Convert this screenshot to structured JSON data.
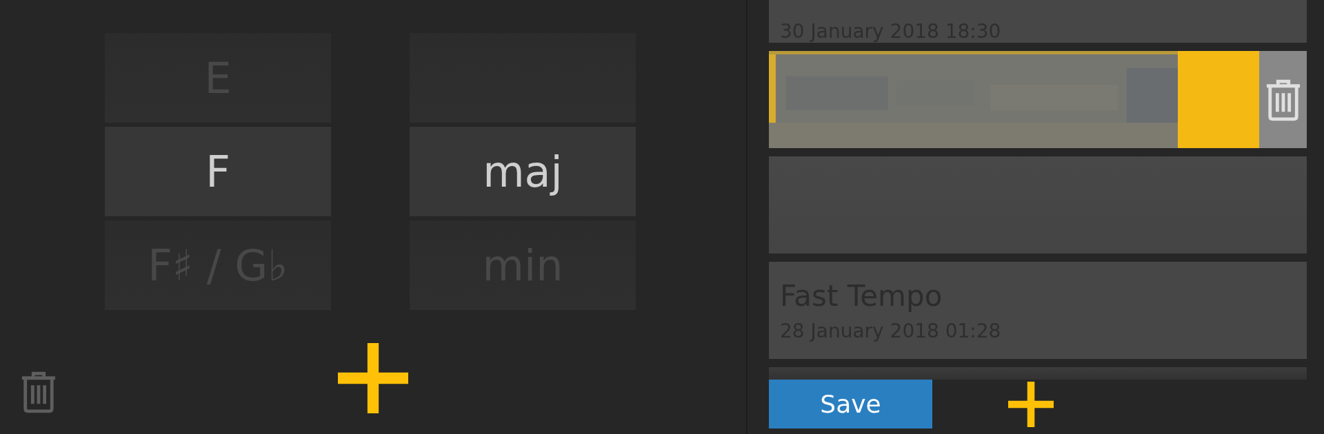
{
  "key_wheel": [
    {
      "label": "E",
      "selected": false
    },
    {
      "label": "F",
      "selected": true
    },
    {
      "label": "F♯ / G♭",
      "selected": false
    }
  ],
  "quality_wheel": [
    {
      "label": "maj",
      "selected": true
    },
    {
      "label": "min",
      "selected": false
    }
  ],
  "presets": [
    {
      "kind": "entry",
      "date": "30 January 2018 18:30"
    },
    {
      "kind": "swiped"
    },
    {
      "kind": "blurred"
    },
    {
      "kind": "entry",
      "name": "Fast Tempo",
      "date": "28 January 2018 01:28"
    },
    {
      "kind": "partial"
    }
  ],
  "save_button": "Save"
}
